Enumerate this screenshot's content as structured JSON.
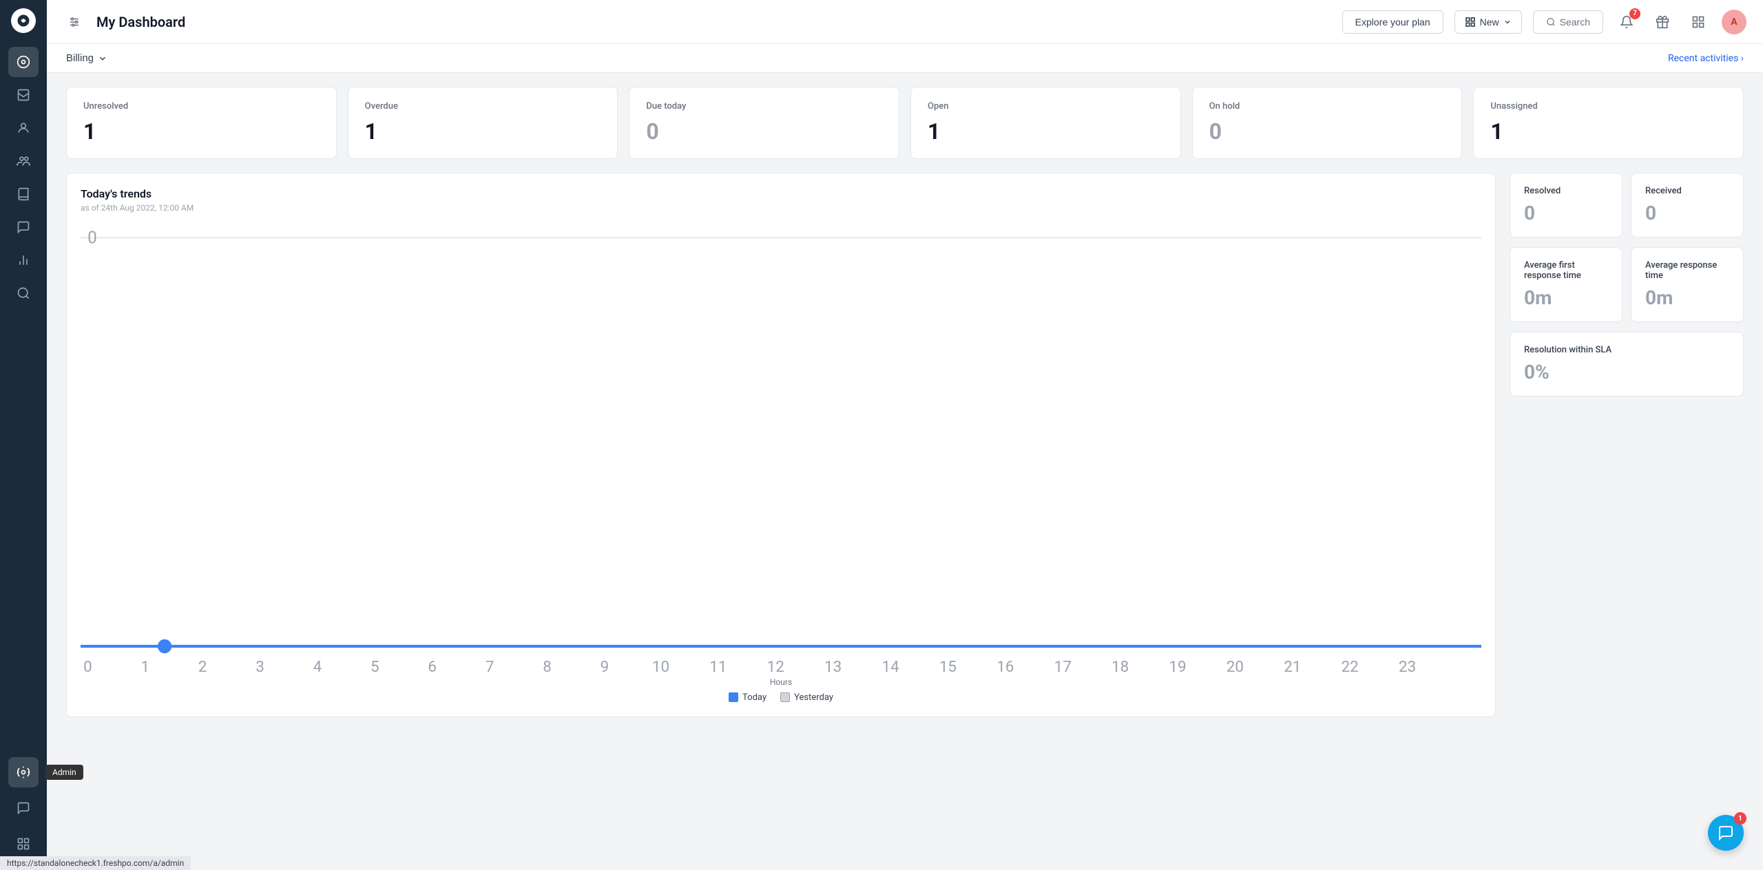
{
  "sidebar": {
    "logo": "G",
    "items": [
      {
        "name": "home",
        "icon": "⊙",
        "active": true
      },
      {
        "name": "inbox",
        "icon": "▭"
      },
      {
        "name": "contacts",
        "icon": "👤"
      },
      {
        "name": "groups",
        "icon": "👥"
      },
      {
        "name": "knowledge",
        "icon": "📖"
      },
      {
        "name": "conversations",
        "icon": "💬"
      },
      {
        "name": "reports",
        "icon": "📊"
      },
      {
        "name": "insights",
        "icon": "🔍"
      }
    ],
    "bottom": [
      {
        "name": "admin",
        "icon": "⚙",
        "tooltip": "Admin"
      },
      {
        "name": "chat",
        "icon": "💬"
      },
      {
        "name": "apps",
        "icon": "⋮⋮⋮"
      }
    ]
  },
  "topbar": {
    "filter_icon": "≡",
    "title": "My Dashboard",
    "explore_plan": "Explore your plan",
    "new_label": "New",
    "search_label": "Search",
    "notification_count": "7",
    "avatar_initial": "A"
  },
  "billing": {
    "label": "Billing",
    "recent_activities": "Recent activities ›"
  },
  "stats": [
    {
      "label": "Unresolved",
      "value": "1",
      "muted": false
    },
    {
      "label": "Overdue",
      "value": "1",
      "muted": false
    },
    {
      "label": "Due today",
      "value": "0",
      "muted": true
    },
    {
      "label": "Open",
      "value": "1",
      "muted": false
    },
    {
      "label": "On hold",
      "value": "0",
      "muted": true
    },
    {
      "label": "Unassigned",
      "value": "1",
      "muted": false
    }
  ],
  "trends": {
    "title": "Today's trends",
    "subtitle": "as of 24th Aug 2022, 12:00 AM",
    "x_labels": [
      "0",
      "1",
      "2",
      "3",
      "4",
      "5",
      "6",
      "7",
      "8",
      "9",
      "10",
      "11",
      "12",
      "13",
      "14",
      "15",
      "16",
      "17",
      "18",
      "19",
      "20",
      "21",
      "22",
      "23"
    ],
    "y_label_top": "0",
    "hours_label": "Hours",
    "legend": {
      "today_label": "Today",
      "yesterday_label": "Yesterday"
    }
  },
  "metrics": [
    {
      "label": "Resolved",
      "value": "0"
    },
    {
      "label": "Received",
      "value": "0"
    },
    {
      "label": "Average first response time",
      "value": "0m"
    },
    {
      "label": "Average response time",
      "value": "0m"
    },
    {
      "label": "Resolution within SLA",
      "value": "0%"
    }
  ],
  "float_chat": {
    "badge": "1"
  },
  "url_bar": "https://standalonecheck1.freshpo.com/a/admin"
}
